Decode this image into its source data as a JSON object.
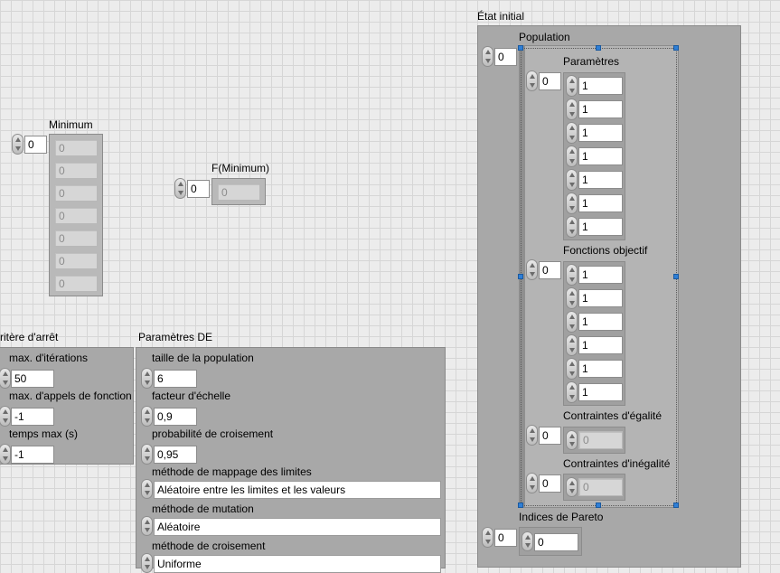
{
  "minimum": {
    "label": "Minimum",
    "index": "0",
    "values": [
      "0",
      "0",
      "0",
      "0",
      "0",
      "0",
      "0"
    ]
  },
  "f_minimum": {
    "label": "F(Minimum)",
    "index": "0",
    "value": "0"
  },
  "critere": {
    "label": "ritère d'arrêt",
    "fields": [
      {
        "label": "max. d'itérations",
        "value": "50"
      },
      {
        "label": "max. d'appels de fonction",
        "value": "-1"
      },
      {
        "label": "temps max (s)",
        "value": "-1"
      }
    ]
  },
  "parametres_de": {
    "label": "Paramètres DE",
    "numeric": [
      {
        "label": "taille de la population",
        "value": "6"
      },
      {
        "label": "facteur d'échelle",
        "value": "0,9"
      },
      {
        "label": "probabilité de croisement",
        "value": "0,95"
      }
    ],
    "enums": [
      {
        "label": "méthode de mappage des limites",
        "value": "Aléatoire entre les limites et les valeurs"
      },
      {
        "label": "méthode de mutation",
        "value": "Aléatoire"
      },
      {
        "label": "méthode de croisement",
        "value": "Uniforme"
      }
    ]
  },
  "etat_initial": {
    "label": "État initial",
    "population": {
      "label": "Population",
      "index": "0",
      "parametres": {
        "label": "Paramètres",
        "index": "0",
        "values": [
          "1",
          "1",
          "1",
          "1",
          "1",
          "1",
          "1"
        ]
      },
      "fonctions_objectif": {
        "label": "Fonctions objectif",
        "index": "0",
        "values": [
          "1",
          "1",
          "1",
          "1",
          "1",
          "1"
        ]
      },
      "contraintes_egalite": {
        "label": "Contraintes d'égalité",
        "index": "0",
        "value": "0"
      },
      "contraintes_inegalite": {
        "label": "Contraintes d'inégalité",
        "index": "0",
        "value": "0"
      }
    },
    "pareto": {
      "label": "Indices de Pareto",
      "index": "0",
      "value": "0"
    }
  }
}
